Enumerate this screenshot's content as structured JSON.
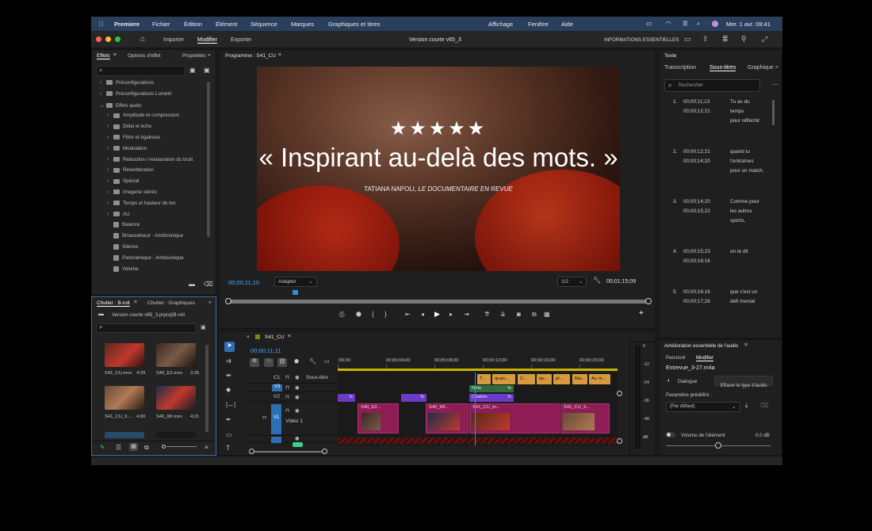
{
  "menubar": {
    "app_name": "Premiere",
    "items": [
      "Fichier",
      "Édition",
      "Élément",
      "Séquence",
      "Marques",
      "Graphiques et titres",
      "Affichage",
      "Fenêtre",
      "Aide"
    ],
    "datetime": "Mer. 1 avr.  09:41"
  },
  "workspace": {
    "tabs": [
      "Importer",
      "Modifier",
      "Exporter"
    ],
    "active_tab": "Modifier",
    "project_title": "Version courte v65_3",
    "essentials": "INFORMATIONS ESSENTIELLES"
  },
  "effects": {
    "tabs": [
      "Effets",
      "Options d'effet",
      "Propriétés"
    ],
    "tree": [
      {
        "label": "Préconfigurations",
        "indent": 0,
        "kind": "folder",
        "open": false
      },
      {
        "label": "Préconfigurations Lumetri",
        "indent": 0,
        "kind": "folder",
        "open": false
      },
      {
        "label": "Effets audio",
        "indent": 0,
        "kind": "folder",
        "open": true
      },
      {
        "label": "Amplitude et compression",
        "indent": 1,
        "kind": "folder",
        "open": false
      },
      {
        "label": "Délai et écho",
        "indent": 1,
        "kind": "folder",
        "open": false
      },
      {
        "label": "Filtre et égaliseur",
        "indent": 1,
        "kind": "folder",
        "open": false
      },
      {
        "label": "Modulation",
        "indent": 1,
        "kind": "folder",
        "open": false
      },
      {
        "label": "Réduction / restauration du bruit",
        "indent": 1,
        "kind": "folder",
        "open": false
      },
      {
        "label": "Réverbération",
        "indent": 1,
        "kind": "folder",
        "open": false
      },
      {
        "label": "Spécial",
        "indent": 1,
        "kind": "folder",
        "open": false
      },
      {
        "label": "Imagerie stéréo",
        "indent": 1,
        "kind": "folder",
        "open": false
      },
      {
        "label": "Temps et hauteur de ton",
        "indent": 1,
        "kind": "folder",
        "open": false
      },
      {
        "label": "AU",
        "indent": 1,
        "kind": "folder",
        "open": false
      },
      {
        "label": "Balance",
        "indent": 1,
        "kind": "effect"
      },
      {
        "label": "Binauraliseur - Ambisonique",
        "indent": 1,
        "kind": "effect"
      },
      {
        "label": "Silence",
        "indent": 1,
        "kind": "effect"
      },
      {
        "label": "Panoramique - Ambisonique",
        "indent": 1,
        "kind": "effect"
      },
      {
        "label": "Volume",
        "indent": 1,
        "kind": "effect"
      }
    ]
  },
  "bin": {
    "tabs": [
      "Chutier : B-roll",
      "Chutier : Graphiques"
    ],
    "path": "Version courte v65_3.prproj\\B-roll",
    "clips": [
      {
        "name": "S41_CU.mov",
        "duration": "4;29"
      },
      {
        "name": "S40_E2.mov",
        "duration": "3;26"
      },
      {
        "name": "S41_CU_9....",
        "duration": "4;00"
      },
      {
        "name": "S40_WI.mov",
        "duration": "4;21"
      }
    ]
  },
  "program": {
    "title": "Programme : S41_CU",
    "stars": "★★★★★",
    "quote": "« Inspirant au-delà des mots. »",
    "credit_name": "TATIANA NAPOLI,",
    "credit_source": "LE DOCUMENTAIRE EN REVUE",
    "timecode": "00;00;11;10",
    "fit": "Adapter",
    "resolution": "1/2",
    "duration": "00;01;15;09",
    "playhead_fraction": 0.155
  },
  "captions": {
    "tabs": [
      "Texte",
      "Transcription",
      "Sous-titres",
      "Graphique"
    ],
    "active_tab": "Sous-titres",
    "search_placeholder": "Rechercher",
    "items": [
      {
        "n": "1.",
        "in": "00;00;11;13",
        "out": "00;00;12;21",
        "text": [
          "Tu as du",
          "temps",
          "pour réfléchir"
        ]
      },
      {
        "n": "2.",
        "in": "00;00;12;21",
        "out": "00;00;14;20",
        "text": [
          "quand tu",
          "t'entraînes",
          "pour un match."
        ]
      },
      {
        "n": "3.",
        "in": "00;00;14;20",
        "out": "00;00;15;23",
        "text": [
          "Comme pour",
          "les autres",
          "sports,"
        ]
      },
      {
        "n": "4.",
        "in": "00;00;15;23",
        "out": "00;00;16;16",
        "text": [
          "on te dit"
        ]
      },
      {
        "n": "5.",
        "in": "00;00;16;16",
        "out": "00;00;17;26",
        "text": [
          "que c'est un",
          "défi mental"
        ]
      }
    ]
  },
  "audio": {
    "title": "Amélioration essentielle de l'audio",
    "tabs": [
      "Parcourir",
      "Modifier"
    ],
    "active_tab": "Modifier",
    "clip": "Entrevue_3-27.m4a",
    "type": "Dialogue",
    "clear_button": "Effacer le type d'audio",
    "preset_label": "Paramètre prédéfini :",
    "preset_value": "(Par défaut)",
    "volume_label": "Volume de l'élément",
    "volume_value": "0.0 dB",
    "volume_level": 0.5
  },
  "timeline": {
    "sequence": "S41_CU",
    "timecode": "00;00;11;11",
    "ruler": [
      ";00;00",
      "00;00;04;00",
      "00;00;08;00",
      "00;00;12;00",
      "00;00;16;00",
      "00;00;20;00"
    ],
    "playhead_fraction": 0.49,
    "tracks": {
      "c1": "C1",
      "subtitle_label": "Sous-titre",
      "v3": "V3",
      "v2": "V2",
      "v1": "V1",
      "video1": "Vidéo 1"
    },
    "caption_clips": [
      "T...",
      "quan...",
      "C...",
      "qu...",
      "pl...",
      "Ma...",
      "Au m..."
    ],
    "v3_clip": "Note",
    "v2_clip": "Citation",
    "fx": "fx",
    "v1_clips": [
      "S40_E2...",
      "S40_WI...",
      "S41_CU_m...",
      "S41_CU_9..."
    ]
  },
  "meter": {
    "scale": [
      "0",
      "-12",
      "-24",
      "-36",
      "-48",
      "dB"
    ]
  },
  "colors": {
    "accent": "#2d8ceb",
    "caption_clip": "#d79a3c",
    "graphic_clip": "#6a3bc4",
    "video_clip": "#8e1d55",
    "menubar": "#2a3f5c"
  }
}
